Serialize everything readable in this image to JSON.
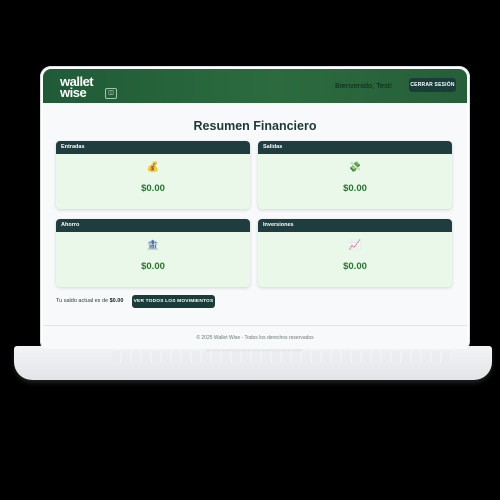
{
  "header": {
    "logo_line1": "wallet",
    "logo_line2": "wise",
    "welcome_prefix": "Bienvenido, ",
    "user_name": "Test",
    "welcome_suffix": "!",
    "logout_label": "CERRAR SESIÓN"
  },
  "main": {
    "title": "Resumen Financiero",
    "cards": [
      {
        "label": "Entradas",
        "icon": "money-bag-icon",
        "glyph": "💰",
        "value": "$0.00"
      },
      {
        "label": "Salidas",
        "icon": "money-flying-icon",
        "glyph": "💸",
        "value": "$0.00"
      },
      {
        "label": "Ahorro",
        "icon": "bank-icon",
        "glyph": "🏦",
        "value": "$0.00"
      },
      {
        "label": "Inversiones",
        "icon": "chart-increasing-icon",
        "glyph": "📈",
        "value": "$0.00"
      }
    ],
    "balance_text": "Tu saldo actual es de",
    "balance_value": "$0.00",
    "movements_button": "VER TODOS LOS MOVIMIENTOS"
  },
  "footer": {
    "text": "© 2025 Wallet Wise - Todos los derechos reservados"
  },
  "colors": {
    "header_green": "#2c6b3e",
    "card_header": "#1f3c3f",
    "card_bg": "#e9f8e9",
    "value_green": "#26762f",
    "button_dark": "#1b3d3a"
  }
}
